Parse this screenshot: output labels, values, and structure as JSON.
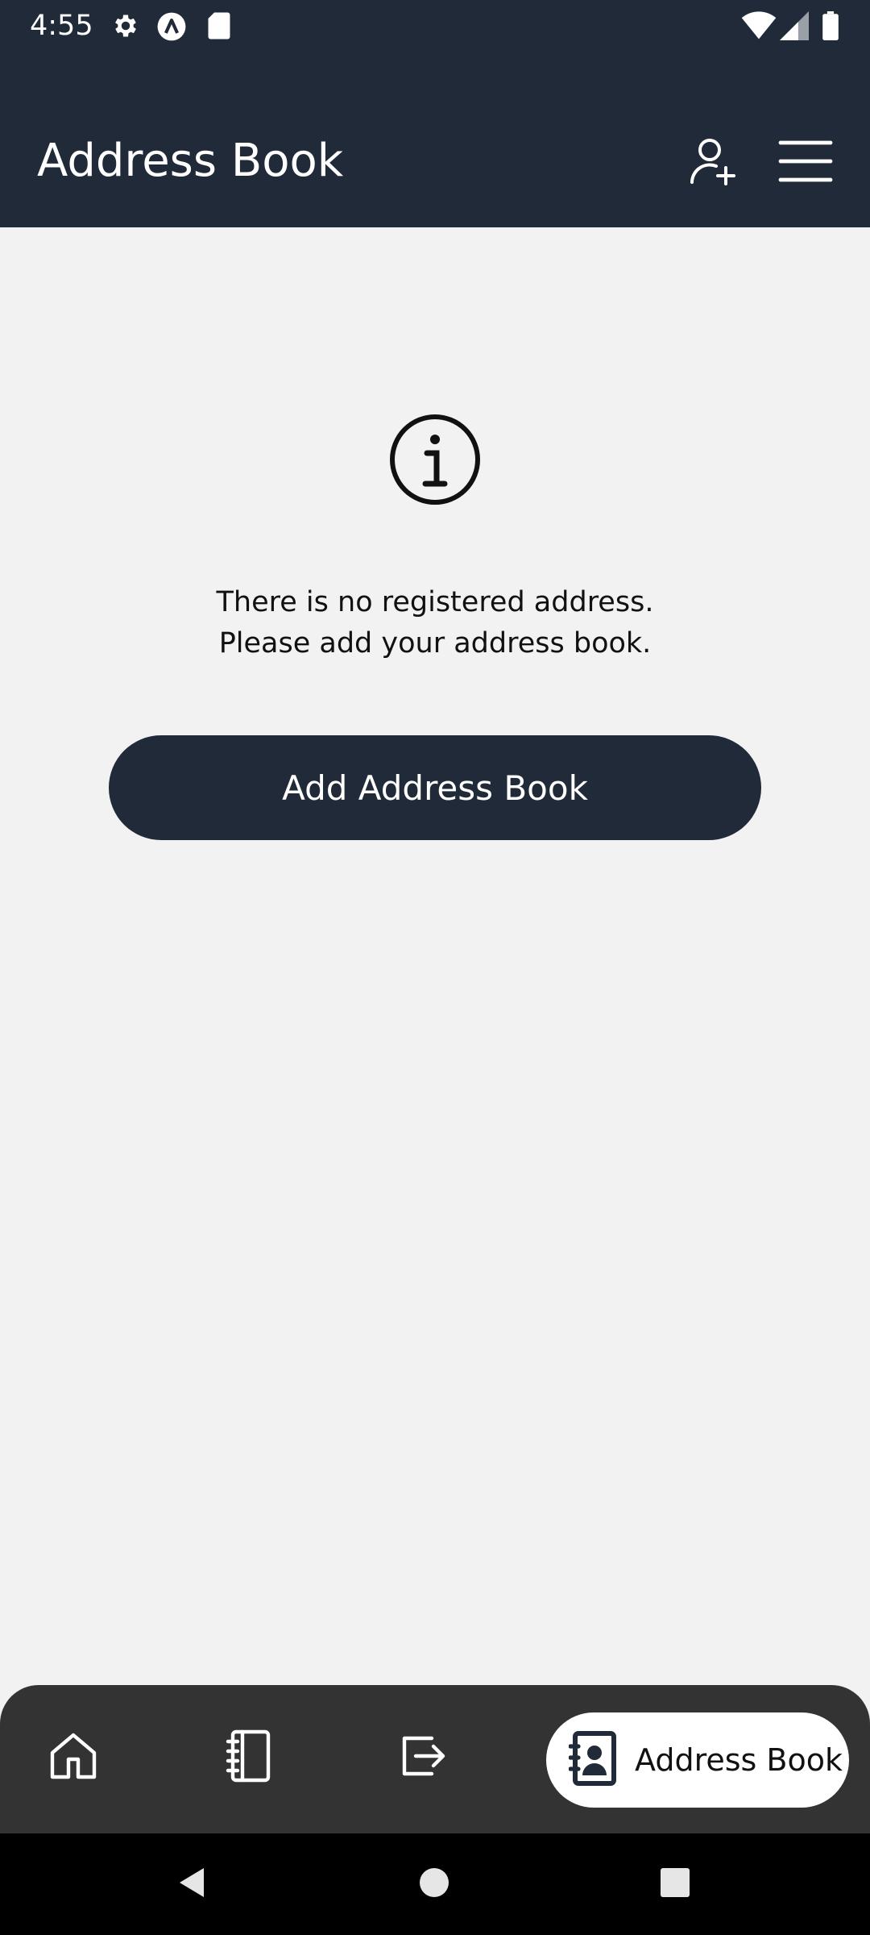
{
  "status_bar": {
    "time": "4:55",
    "icons": [
      "settings-icon",
      "app-a-icon",
      "sd-card-icon",
      "wifi-icon",
      "signal-icon",
      "battery-icon"
    ]
  },
  "app_bar": {
    "title": "Address Book",
    "actions": [
      "add-person-icon",
      "menu-icon"
    ]
  },
  "empty_state": {
    "icon": "info-icon",
    "line1": "There is no registered address.",
    "line2": "Please add your address book.",
    "button_label": "Add Address Book"
  },
  "bottom_nav": {
    "items": [
      {
        "icon": "home-icon"
      },
      {
        "icon": "notebook-icon"
      },
      {
        "icon": "export-icon"
      },
      {
        "icon": "contact-book-icon",
        "label": "Address Book",
        "active": true
      }
    ]
  },
  "colors": {
    "primary": "#212a39",
    "background": "#f2f2f2",
    "nav_background": "#333333"
  }
}
